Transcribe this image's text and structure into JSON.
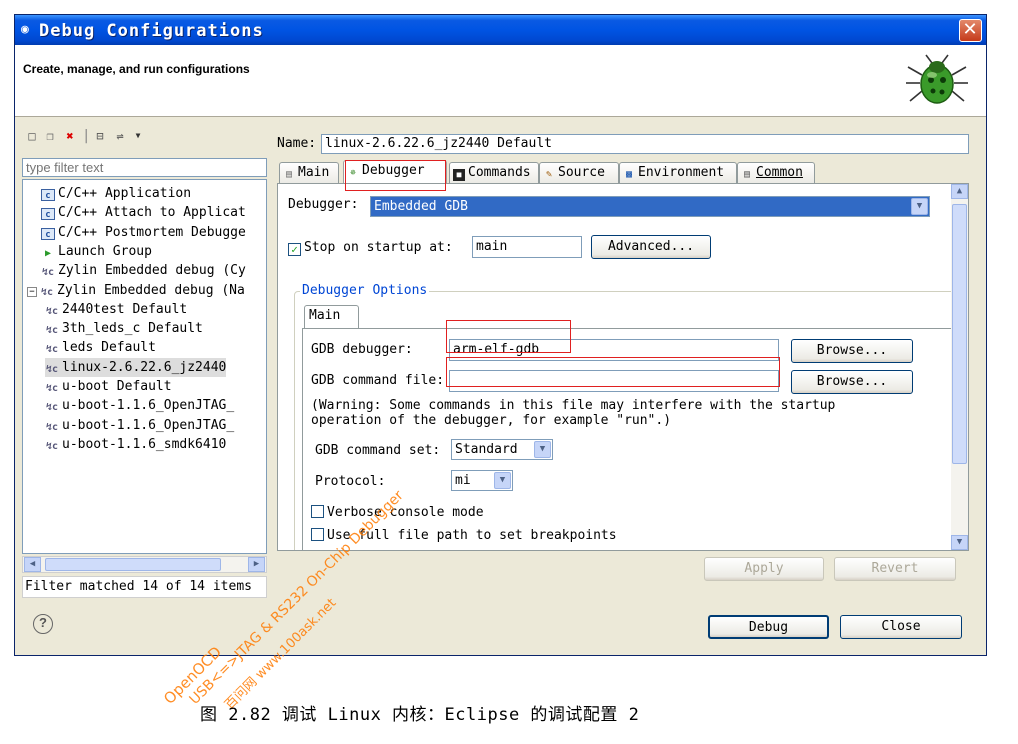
{
  "window": {
    "title": "Debug Configurations",
    "header": "Create, manage, and run configurations"
  },
  "left": {
    "filter_placeholder": "type filter text",
    "tree": [
      {
        "label": "C/C++ Application",
        "icon": "c-app-icon"
      },
      {
        "label": "C/C++ Attach to Applicat",
        "icon": "c-app-icon"
      },
      {
        "label": "C/C++ Postmortem Debugge",
        "icon": "c-app-icon"
      },
      {
        "label": "Launch Group",
        "icon": "launch-group-icon"
      },
      {
        "label": "Zylin Embedded debug (Cy",
        "icon": "zylin-icon"
      },
      {
        "label": "Zylin Embedded debug (Na",
        "icon": "zylin-icon"
      },
      {
        "label": "2440test Default",
        "icon": "zylin-config-icon"
      },
      {
        "label": "3th_leds_c Default",
        "icon": "zylin-config-icon"
      },
      {
        "label": "leds Default",
        "icon": "zylin-config-icon"
      },
      {
        "label": "linux-2.6.22.6_jz2440",
        "icon": "zylin-config-icon",
        "selected": true
      },
      {
        "label": "u-boot Default",
        "icon": "zylin-config-icon"
      },
      {
        "label": "u-boot-1.1.6_OpenJTAG_",
        "icon": "zylin-config-icon"
      },
      {
        "label": "u-boot-1.1.6_OpenJTAG_",
        "icon": "zylin-config-icon"
      },
      {
        "label": "u-boot-1.1.6_smdk6410",
        "icon": "zylin-config-icon"
      }
    ],
    "status": "Filter matched 14 of 14 items"
  },
  "config": {
    "name_label": "Name:",
    "name_value": "linux-2.6.22.6_jz2440 Default",
    "tabs": [
      "Main",
      "Debugger",
      "Commands",
      "Source",
      "Environment",
      "Common"
    ],
    "active_tab": "Debugger",
    "debugger_label": "Debugger:",
    "debugger_value": "Embedded GDB",
    "stop_label": "Stop on startup at:",
    "stop_checked": true,
    "stop_value": "main",
    "advanced": "Advanced...",
    "options_title": "Debugger Options",
    "inner_tab": "Main",
    "gdb_debugger_label": "GDB debugger:",
    "gdb_debugger_value": "arm-elf-gdb",
    "browse1": "Browse...",
    "gdb_cmd_file_label": "GDB command file:",
    "gdb_cmd_file_value": "",
    "browse2": "Browse...",
    "warning_line1": "(Warning: Some commands in this file may interfere with the startup",
    "warning_line2": "operation of the debugger, for example \"run\".)",
    "cmd_set_label": "GDB command set:",
    "cmd_set_value": "Standard",
    "protocol_label": "Protocol:",
    "protocol_value": "mi",
    "verbose_label": "Verbose console mode",
    "fullpath_label": "Use full file path to set breakpoints"
  },
  "buttons": {
    "apply": "Apply",
    "revert": "Revert",
    "debug": "Debug",
    "close": "Close",
    "help": "?"
  },
  "watermark": {
    "line1": "OpenOCD",
    "line2": "USB<=>JTAG & RS232 On-Chip Debugger",
    "line3": "百问网 www.100ask.net"
  },
  "caption": "图 2.82 调试 Linux 内核：Eclipse 的调试配置 2"
}
